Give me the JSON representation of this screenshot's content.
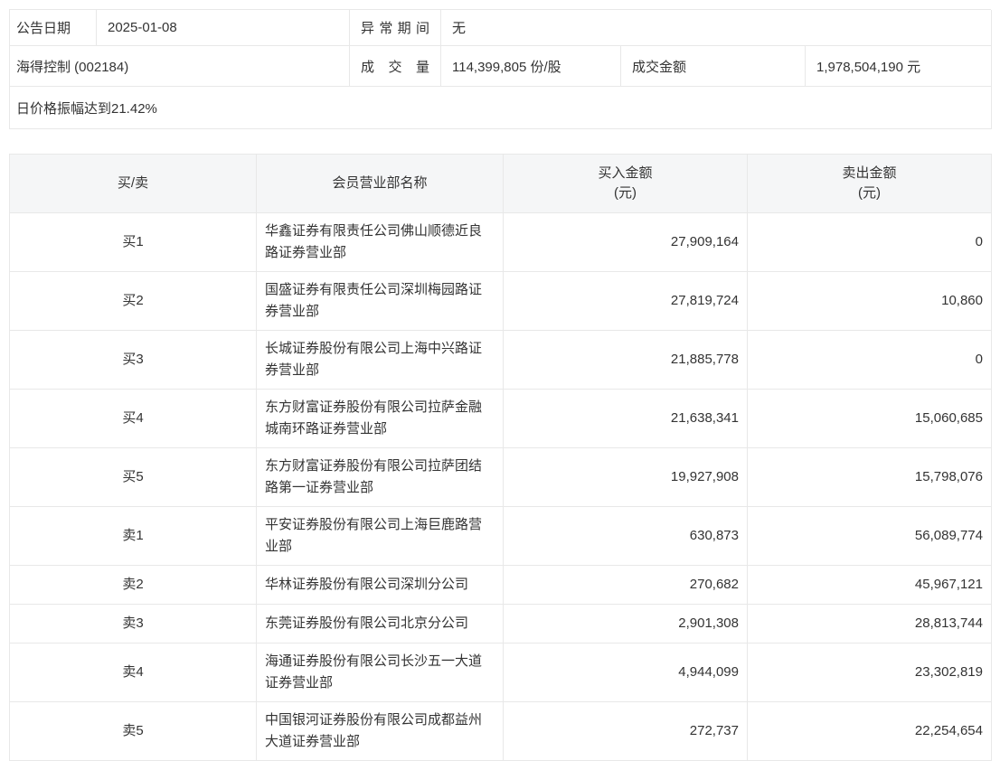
{
  "info_panel": {
    "announcement_date_label": "公告日期",
    "announcement_date_value": "2025-01-08",
    "abnormal_period_label": "异常期间",
    "abnormal_period_value": "无",
    "stock_name": "海得控制 (002184)",
    "volume_label": "成交量",
    "volume_value": "114,399,805 份/股",
    "turnover_label": "成交金额",
    "turnover_value": "1,978,504,190 元",
    "reason_note": "日价格振幅达到21.42%"
  },
  "table": {
    "headers": {
      "side": "买/卖",
      "broker": "会员营业部名称",
      "buy_line1": "买入金额",
      "buy_line2": "(元)",
      "sell_line1": "卖出金额",
      "sell_line2": "(元)"
    },
    "rows": [
      {
        "side": "买1",
        "broker": "华鑫证券有限责任公司佛山顺德近良路证券营业部",
        "buy": "27,909,164",
        "sell": "0"
      },
      {
        "side": "买2",
        "broker": "国盛证券有限责任公司深圳梅园路证券营业部",
        "buy": "27,819,724",
        "sell": "10,860"
      },
      {
        "side": "买3",
        "broker": "长城证券股份有限公司上海中兴路证券营业部",
        "buy": "21,885,778",
        "sell": "0"
      },
      {
        "side": "买4",
        "broker": "东方财富证券股份有限公司拉萨金融城南环路证券营业部",
        "buy": "21,638,341",
        "sell": "15,060,685"
      },
      {
        "side": "买5",
        "broker": "东方财富证券股份有限公司拉萨团结路第一证券营业部",
        "buy": "19,927,908",
        "sell": "15,798,076"
      },
      {
        "side": "卖1",
        "broker": "平安证券股份有限公司上海巨鹿路营业部",
        "buy": "630,873",
        "sell": "56,089,774"
      },
      {
        "side": "卖2",
        "broker": "华林证券股份有限公司深圳分公司",
        "buy": "270,682",
        "sell": "45,967,121"
      },
      {
        "side": "卖3",
        "broker": "东莞证券股份有限公司北京分公司",
        "buy": "2,901,308",
        "sell": "28,813,744"
      },
      {
        "side": "卖4",
        "broker": "海通证券股份有限公司长沙五一大道证券营业部",
        "buy": "4,944,099",
        "sell": "23,302,819"
      },
      {
        "side": "卖5",
        "broker": "中国银河证券股份有限公司成都益州大道证券营业部",
        "buy": "272,737",
        "sell": "22,254,654"
      }
    ]
  },
  "colors": {
    "border": "#e8e8e8",
    "header_bg": "#f5f6f7",
    "text": "#333333"
  }
}
